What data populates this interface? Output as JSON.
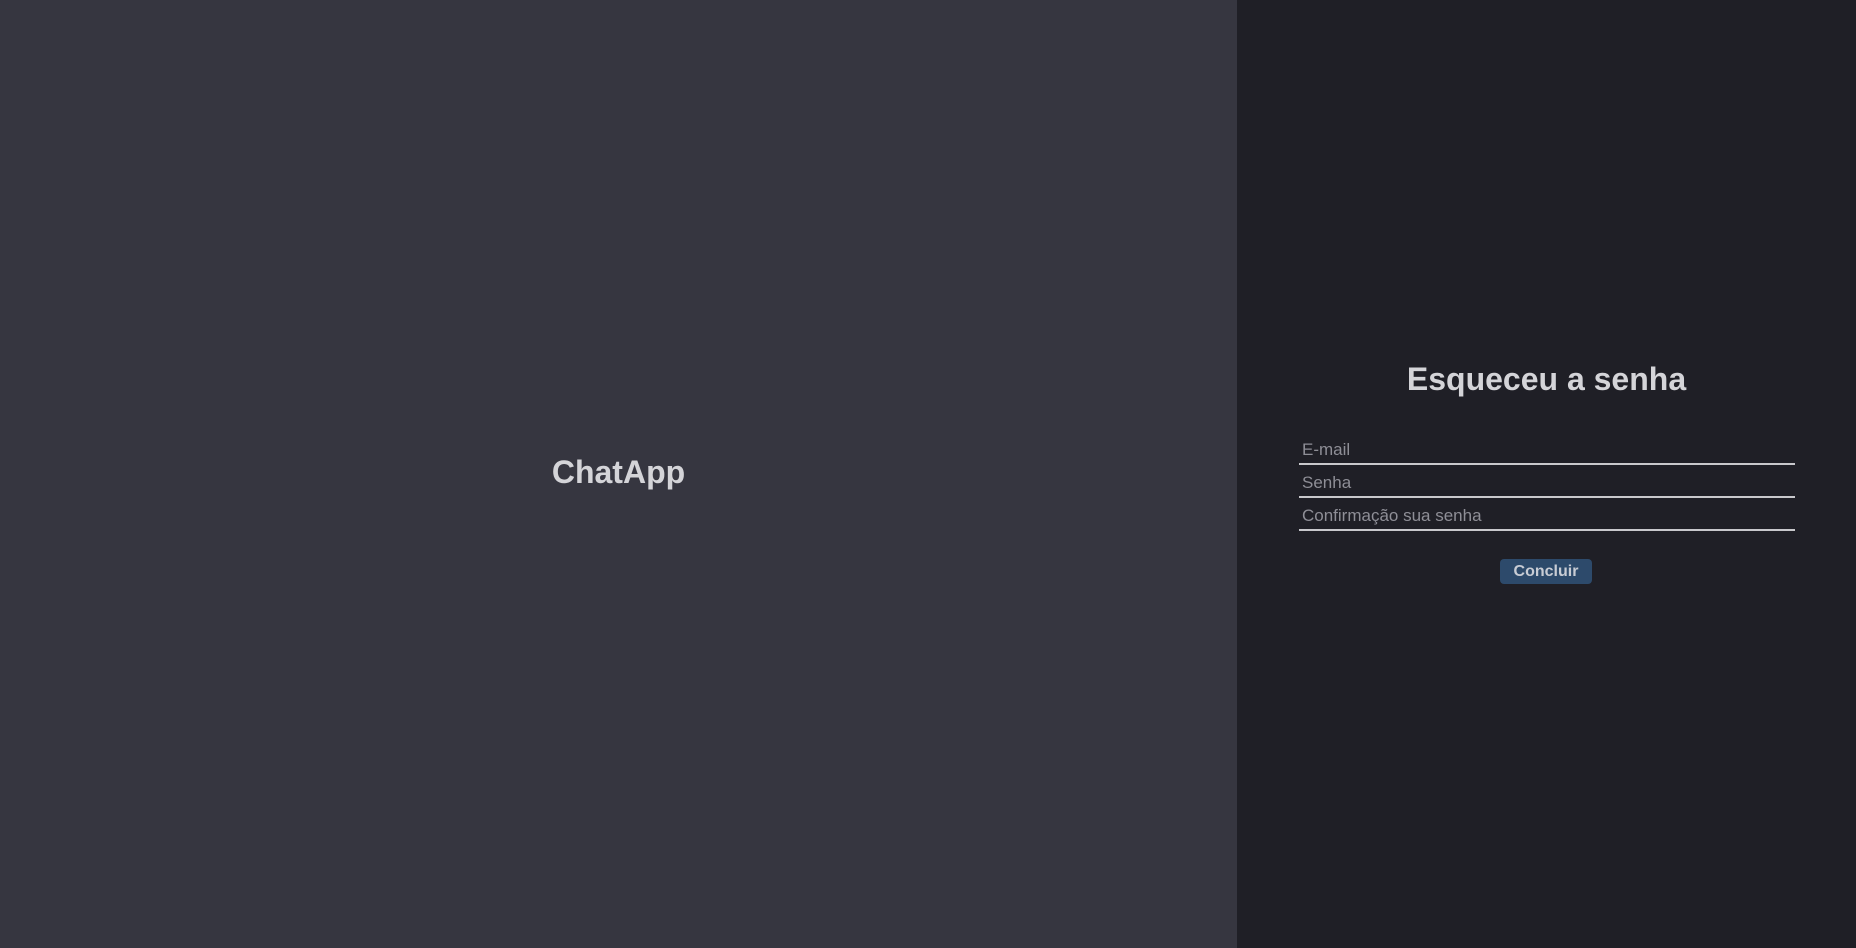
{
  "brand": {
    "app_name": "ChatApp"
  },
  "form": {
    "title": "Esqueceu a senha",
    "email_placeholder": "E-mail",
    "password_placeholder": "Senha",
    "confirm_placeholder": "Confirmação sua senha",
    "submit_label": "Concluir"
  },
  "colors": {
    "left_panel_bg": "#363640",
    "right_panel_bg": "#1f1f26",
    "text": "#d4d4d8",
    "button_bg": "#2d4a6b"
  }
}
